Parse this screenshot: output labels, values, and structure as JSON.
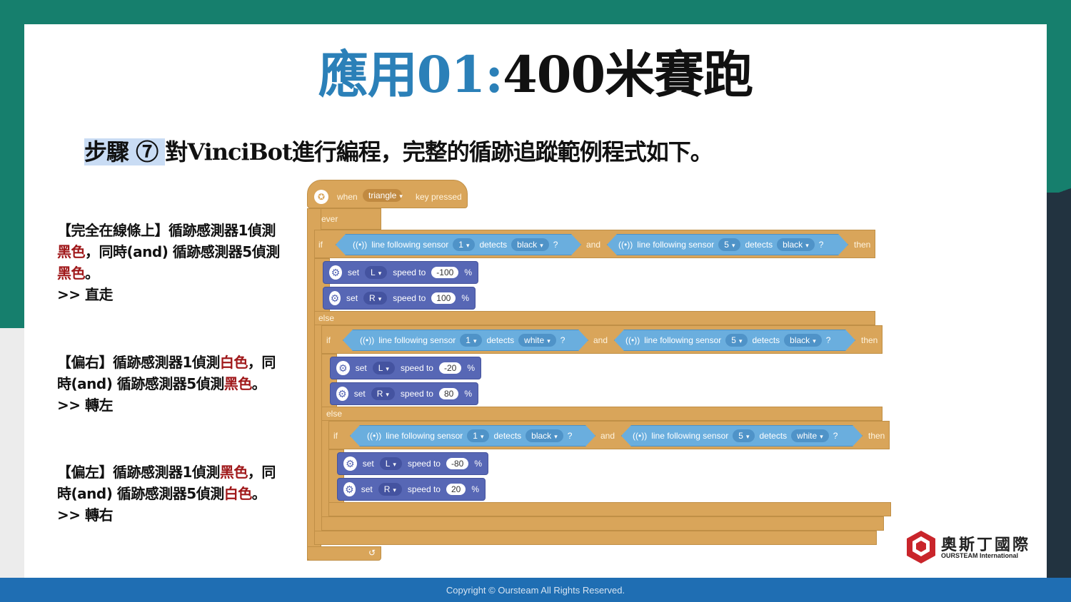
{
  "slide": {
    "title_part1": "應用01",
    "title_sep": ":",
    "title_part2": "400米賽跑",
    "step_label": "步驟 ⑦ ",
    "step_text": "對VinciBot進行編程，完整的循跡追蹤範例程式如下。",
    "footer": "Copyright © Oursteam All Rights Reserved."
  },
  "notes": [
    {
      "p1": "【完全在線條上】循跡感測器1偵測",
      "r1": "黑色",
      "p2": "，同時(and) 循跡感測器5偵測",
      "r2": "黑色",
      "p3": "。",
      "p4": ">> 直走"
    },
    {
      "p1": "【偏右】循跡感測器1偵測",
      "r1": "白色",
      "p2": "，同時(and) 循跡感測器5偵測",
      "r2": "黑色",
      "p3": "。>> 轉左"
    },
    {
      "p1": "【偏左】循跡感測器1偵測",
      "r1": "黑色",
      "p2": "，同時(and) 循跡感測器5偵測",
      "r2": "白色",
      "p3": "。>> 轉右"
    }
  ],
  "code": {
    "hat": {
      "when": "when",
      "key": "triangle",
      "suffix": "key pressed"
    },
    "forever": "forever",
    "kw_if": "if",
    "kw_else": "else",
    "kw_then": "then",
    "kw_and": "and",
    "sensor_label": "line following sensor",
    "detects": "detects",
    "q": "?",
    "set": "set",
    "speed_to": "speed to",
    "percent": "%",
    "conditions": [
      {
        "s1": "1",
        "c1": "black",
        "s2": "5",
        "c2": "black"
      },
      {
        "s1": "1",
        "c1": "white",
        "s2": "5",
        "c2": "black"
      },
      {
        "s1": "1",
        "c1": "black",
        "s2": "5",
        "c2": "white"
      }
    ],
    "motors": [
      {
        "side": "L",
        "speed": "-100"
      },
      {
        "side": "R",
        "speed": "100"
      },
      {
        "side": "L",
        "speed": "-20"
      },
      {
        "side": "R",
        "speed": "80"
      },
      {
        "side": "L",
        "speed": "-80"
      },
      {
        "side": "R",
        "speed": "20"
      }
    ]
  },
  "logo": {
    "cn": "奧斯丁國際",
    "en": "OURSTEAM International"
  },
  "colors": {
    "teal": "#167f6d",
    "title_blue": "#2b80b8",
    "accent_red": "#a0191b",
    "footer_blue": "#1f6eb3"
  }
}
